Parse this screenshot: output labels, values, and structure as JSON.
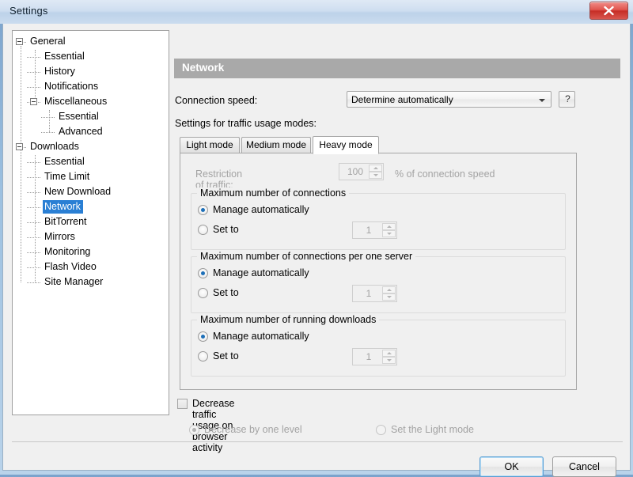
{
  "window": {
    "title": "Settings",
    "close_icon": "close-icon"
  },
  "tree": {
    "items": [
      {
        "label": "General",
        "level": 0,
        "expander": true,
        "selected": false
      },
      {
        "label": "Essential",
        "level": 1,
        "expander": false,
        "selected": false
      },
      {
        "label": "History",
        "level": 1,
        "expander": false,
        "selected": false
      },
      {
        "label": "Notifications",
        "level": 1,
        "expander": false,
        "selected": false
      },
      {
        "label": "Miscellaneous",
        "level": 1,
        "expander": true,
        "selected": false
      },
      {
        "label": "Essential",
        "level": 2,
        "expander": false,
        "selected": false
      },
      {
        "label": "Advanced",
        "level": 2,
        "expander": false,
        "selected": false
      },
      {
        "label": "Downloads",
        "level": 0,
        "expander": true,
        "selected": false
      },
      {
        "label": "Essential",
        "level": 1,
        "expander": false,
        "selected": false
      },
      {
        "label": "Time Limit",
        "level": 1,
        "expander": false,
        "selected": false
      },
      {
        "label": "New Download",
        "level": 1,
        "expander": false,
        "selected": false
      },
      {
        "label": "Network",
        "level": 1,
        "expander": false,
        "selected": true
      },
      {
        "label": "BitTorrent",
        "level": 1,
        "expander": false,
        "selected": false
      },
      {
        "label": "Mirrors",
        "level": 1,
        "expander": false,
        "selected": false
      },
      {
        "label": "Monitoring",
        "level": 1,
        "expander": false,
        "selected": false
      },
      {
        "label": "Flash Video",
        "level": 1,
        "expander": false,
        "selected": false
      },
      {
        "label": "Site Manager",
        "level": 1,
        "expander": false,
        "selected": false
      }
    ]
  },
  "section": {
    "header": "Network",
    "header_bg": "#a9a9a9",
    "header_text_color": "#ffffff"
  },
  "connection_speed": {
    "label": "Connection speed:",
    "value": "Determine automatically",
    "options": [
      "Determine automatically"
    ],
    "help_label": "?",
    "dropdown_icon": "chevron-down-icon"
  },
  "traffic_modes": {
    "label": "Settings for traffic usage modes:",
    "tabs": [
      {
        "label": "Light mode",
        "active": false
      },
      {
        "label": "Medium mode",
        "active": false
      },
      {
        "label": "Heavy mode",
        "active": true
      }
    ]
  },
  "restriction": {
    "label": "Restriction of traffic:",
    "value": "100",
    "suffix": "% of connection speed",
    "disabled": true
  },
  "groups": [
    {
      "title": "Maximum number of connections",
      "auto_label": "Manage automatically",
      "auto_selected": true,
      "setto_label": "Set to",
      "setto_selected": false,
      "setto_value": "1",
      "setto_disabled": true
    },
    {
      "title": "Maximum number of connections per one server",
      "auto_label": "Manage automatically",
      "auto_selected": true,
      "setto_label": "Set to",
      "setto_selected": false,
      "setto_value": "1",
      "setto_disabled": true
    },
    {
      "title": "Maximum number of running downloads",
      "auto_label": "Manage automatically",
      "auto_selected": true,
      "setto_label": "Set to",
      "setto_selected": false,
      "setto_value": "1",
      "setto_disabled": true
    }
  ],
  "browser_activity": {
    "checkbox_label": "Decrease traffic usage on browser activity",
    "checked": false,
    "option_one": {
      "label": "Decrease by one level",
      "selected": true,
      "disabled": true
    },
    "option_two": {
      "label": "Set the Light mode",
      "selected": false,
      "disabled": true
    }
  },
  "footer": {
    "ok_label": "OK",
    "cancel_label": "Cancel"
  },
  "colors": {
    "selection_blue": "#2a7fd4",
    "radio_blue": "#1d6fb8",
    "disabled_gray": "#a3a3a3"
  }
}
